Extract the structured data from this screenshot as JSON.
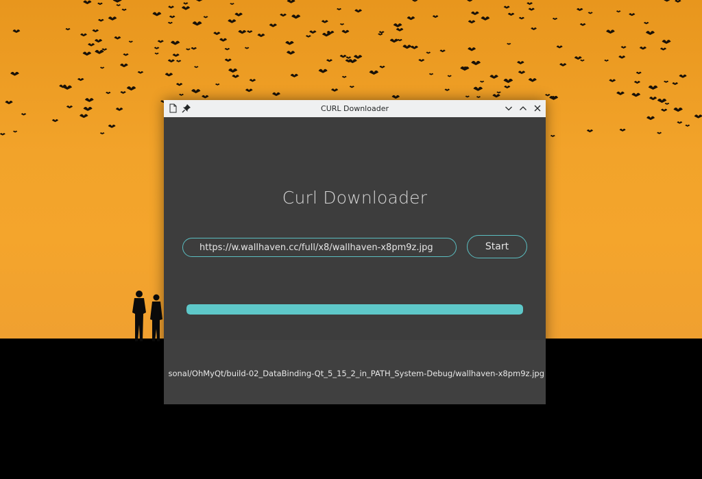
{
  "window": {
    "title": "CURL Downloader",
    "controls": [
      "minimize",
      "maximize",
      "close"
    ]
  },
  "main": {
    "heading": "Curl Downloader",
    "url_input": {
      "value": "https://w.wallhaven.cc/full/x8/wallhaven-x8pm9z.jpg",
      "placeholder": ""
    },
    "start_label": "Start",
    "progress": 1.0,
    "output_path": "sonal/OhMyQt/build-02_DataBinding-Qt_5_15_2_in_PATH_System-Debug/wallhaven-x8pm9z.jpg"
  },
  "colors": {
    "accent": "#5ec8c9",
    "window_bg": "#3d3d3d",
    "titlebar_bg": "#eff0f1",
    "sky": "#f2a32a"
  },
  "icons": {
    "app": "document-icon",
    "pin": "pin-icon",
    "minimize": "chevron-down-icon",
    "maximize": "chevron-up-icon",
    "close": "close-icon"
  }
}
